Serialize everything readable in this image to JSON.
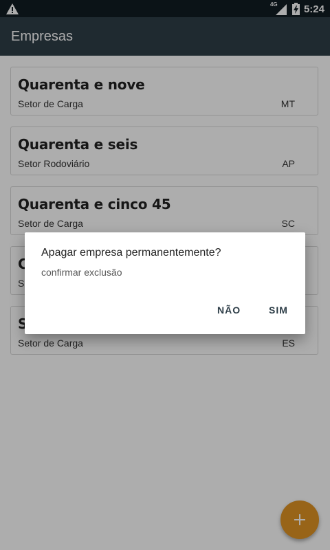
{
  "status_bar": {
    "network": "4G",
    "time": "5:24",
    "icons": [
      "warning-icon",
      "signal-icon",
      "battery-charging-icon"
    ]
  },
  "appbar": {
    "title": "Empresas"
  },
  "companies": [
    {
      "name": "Quarenta e nove",
      "sector": "Setor de Carga",
      "state": "MT"
    },
    {
      "name": "Quarenta e seis",
      "sector": "Setor Rodoviário",
      "state": "AP"
    },
    {
      "name": "Quarenta e cinco 45",
      "sector": "Setor de Carga",
      "state": "SC"
    },
    {
      "name": "C",
      "sector": "Se",
      "state": ""
    },
    {
      "name": "S",
      "sector": "Setor de Carga",
      "state": "ES"
    }
  ],
  "dialog": {
    "title": "Apagar empresa permanentemente?",
    "message": "confirmar exclusão",
    "negative": "NÃO",
    "positive": "SIM"
  },
  "fab": {
    "icon": "plus-icon"
  },
  "colors": {
    "appbar": "#2e3e48",
    "status_bar": "#111c22",
    "fab": "#e09424",
    "dialog_button_text": "#2e3e48"
  }
}
